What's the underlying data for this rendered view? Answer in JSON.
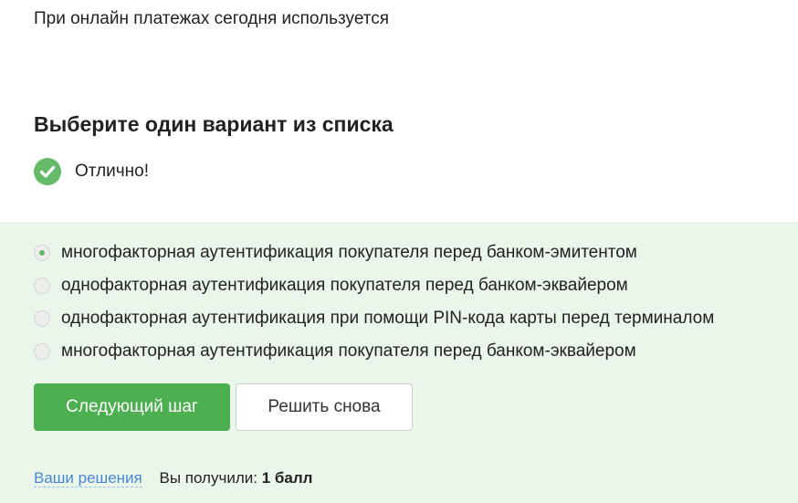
{
  "question": {
    "text": "При онлайн платежах сегодня используется"
  },
  "instruction": "Выберите один вариант из списка",
  "result": {
    "text": "Отлично!",
    "icon": "check-circle-icon",
    "color": "#66bb6a"
  },
  "options": [
    {
      "label": "многофакторная аутентификация покупателя перед банком-эмитентом",
      "selected": true
    },
    {
      "label": "однофакторная аутентификация покупателя перед банком-эквайером",
      "selected": false
    },
    {
      "label": "однофакторная аутентификация при помощи PIN-кода карты перед терминалом",
      "selected": false
    },
    {
      "label": "многофакторная аутентификация покупателя перед банком-эквайером",
      "selected": false
    }
  ],
  "actions": {
    "next_label": "Следующий шаг",
    "retry_label": "Решить снова"
  },
  "footer": {
    "solutions_link": "Ваши решения",
    "score_label": "Вы получили:",
    "score_value": "1 балл"
  },
  "colors": {
    "accent": "#4caf50",
    "panel_bg": "#e9f6e9",
    "link": "#4a86d6"
  }
}
